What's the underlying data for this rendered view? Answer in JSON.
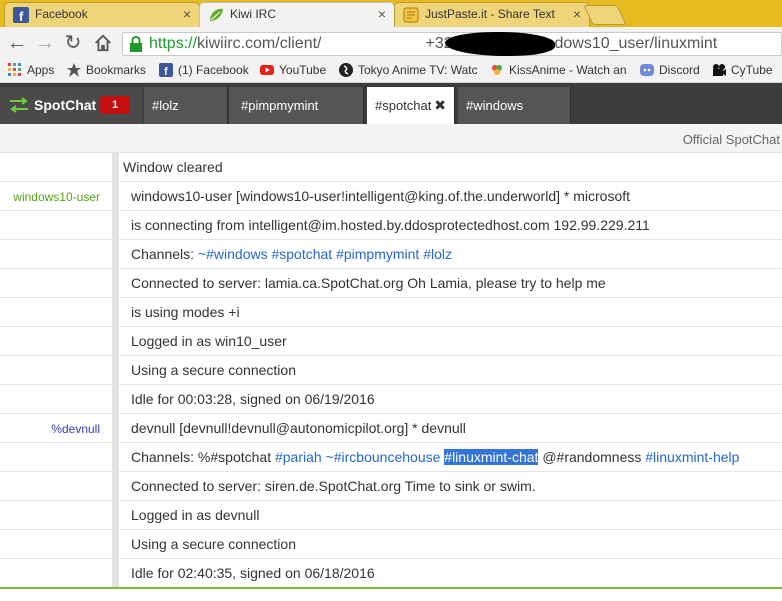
{
  "browser": {
    "tabs": [
      {
        "title": "Facebook",
        "icon": "facebook-icon",
        "active": false
      },
      {
        "title": "Kiwi IRC",
        "icon": "kiwi-leaf-icon",
        "active": true
      },
      {
        "title": "JustPaste.it - Share Text &",
        "icon": "justpaste-icon",
        "active": false
      }
    ],
    "close_glyph": "×",
    "url_proto": "https://",
    "url_host": "kiwiirc.com/client/",
    "url_rest": "+32767/?nick=windows10_user/linuxmint"
  },
  "bookmarks": [
    {
      "label": "Apps",
      "icon": "apps-grid-icon"
    },
    {
      "label": "Bookmarks",
      "icon": "star-icon"
    },
    {
      "label": "(1) Facebook",
      "icon": "facebook-icon"
    },
    {
      "label": "YouTube",
      "icon": "youtube-icon"
    },
    {
      "label": "Tokyo Anime TV: Watc",
      "icon": "tokyo-anime-icon"
    },
    {
      "label": "KissAnime - Watch an",
      "icon": "kissanime-icon"
    },
    {
      "label": "Discord",
      "icon": "discord-icon"
    },
    {
      "label": "CyTube",
      "icon": "cytube-icon"
    }
  ],
  "irc": {
    "network": "SpotChat",
    "badge": "1",
    "channel_tabs": [
      {
        "label": "#lolz"
      },
      {
        "label": "#pimpmymint"
      },
      {
        "label": "#spotchat",
        "active": true,
        "close": "✖"
      },
      {
        "label": "#windows"
      }
    ],
    "topic": "Official SpotChat"
  },
  "messages": [
    {
      "nick": "",
      "text": "Window cleared",
      "system": true
    },
    {
      "nick": "windows10-user",
      "nick_color": "#5a9e1e",
      "text": "windows10-user [windows10-user!intelligent@king.of.the.underworld] * microsoft"
    },
    {
      "nick": "",
      "text": "is connecting from intelligent@im.hosted.by.ddosprotectedhost.com 192.99.229.211"
    },
    {
      "nick": "",
      "parts": [
        {
          "t": "Channels: "
        },
        {
          "t": "~#windows #spotchat #pimpmymint #lolz",
          "c": "chan"
        }
      ]
    },
    {
      "nick": "",
      "text": "Connected to server: lamia.ca.SpotChat.org Oh Lamia, please try to help me"
    },
    {
      "nick": "",
      "text": "is using modes +i"
    },
    {
      "nick": "",
      "text": "Logged in as win10_user"
    },
    {
      "nick": "",
      "text": "Using a secure connection"
    },
    {
      "nick": "",
      "text": "Idle for 00:03:28, signed on 06/19/2016"
    },
    {
      "nick": "%devnull",
      "nick_color": "#3a3ab8",
      "text": "devnull [devnull!devnull@autonomicpilot.org] * devnull"
    },
    {
      "nick": "",
      "parts": [
        {
          "t": "Channels: %#spotchat "
        },
        {
          "t": "#pariah ~#ircbouncehouse",
          "c": "chan"
        },
        {
          "t": " "
        },
        {
          "t": "#linuxmint-chat",
          "c": "hl"
        },
        {
          "t": " @#randomness "
        },
        {
          "t": "#linuxmint-help",
          "c": "chan"
        }
      ]
    },
    {
      "nick": "",
      "text": "Connected to server: siren.de.SpotChat.org Time to sink or swim."
    },
    {
      "nick": "",
      "text": "Logged in as devnull"
    },
    {
      "nick": "",
      "text": "Using a secure connection"
    },
    {
      "nick": "",
      "text": "Idle for 02:40:35, signed on 06/18/2016"
    }
  ]
}
